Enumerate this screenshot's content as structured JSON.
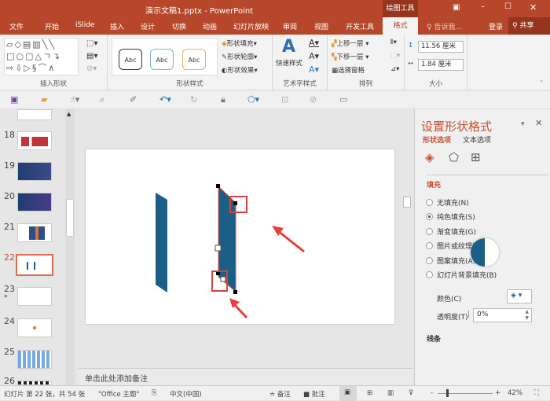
{
  "window": {
    "title": "演示文稿1.pptx - PowerPoint",
    "context_tab": "绘图工具",
    "controls": [
      "restore",
      "minimize",
      "maximize",
      "close"
    ]
  },
  "tabs": [
    "文件",
    "开始",
    "iSlide",
    "插入",
    "设计",
    "切换",
    "动画",
    "幻灯片放映",
    "审阅",
    "视图",
    "开发工具",
    "格式"
  ],
  "active_tab": "格式",
  "tell_me": "告诉我...",
  "login": "登录",
  "share": "共享",
  "ribbon": {
    "groups": {
      "insert_shapes": "插入形状",
      "shape_styles": "形状样式",
      "wordart": "艺术字样式",
      "arrange": "排列",
      "size": "大小"
    },
    "style_samples": [
      "Abc",
      "Abc",
      "Abc"
    ],
    "shape_fill": "形状填充",
    "shape_outline": "形状轮廓",
    "shape_effects": "形状效果",
    "quick_styles": "快速样式",
    "bring_forward": "上移一层",
    "send_backward": "下移一层",
    "selection_pane": "选择窗格",
    "height": "11.56 厘米",
    "width": "1.84 厘米"
  },
  "thumbnails": [
    {
      "num": "18"
    },
    {
      "num": "19"
    },
    {
      "num": "20"
    },
    {
      "num": "21"
    },
    {
      "num": "22",
      "selected": true
    },
    {
      "num": "23",
      "star": "*"
    },
    {
      "num": "24"
    },
    {
      "num": "25"
    },
    {
      "num": "26"
    }
  ],
  "notes_placeholder": "单击此处添加备注",
  "format_pane": {
    "title": "设置形状格式",
    "tabs": [
      "形状选项",
      "文本选项"
    ],
    "section_fill": "填充",
    "fill_options": [
      {
        "label": "无填充(N)",
        "checked": false
      },
      {
        "label": "纯色填充(S)",
        "checked": true
      },
      {
        "label": "渐变填充(G)",
        "checked": false
      },
      {
        "label": "图片或纹理填充(P)",
        "checked": false
      },
      {
        "label": "图案填充(A)",
        "checked": false
      },
      {
        "label": "幻灯片背景填充(B)",
        "checked": false
      }
    ],
    "color_label": "颜色(C)",
    "transparency_label": "透明度(T)",
    "transparency_value": "0%",
    "section_line": "线条"
  },
  "status": {
    "slide_info": "幻灯片 第 22 张，共 54 张",
    "theme": "\"Office 主题\"",
    "language": "中文(中国)",
    "notes": "备注",
    "comments": "批注",
    "zoom": "42%",
    "zoom_value": 42
  },
  "colors": {
    "accent": "#b7472a",
    "shape_fill": "#1c5f86",
    "highlight": "#d9413a"
  }
}
